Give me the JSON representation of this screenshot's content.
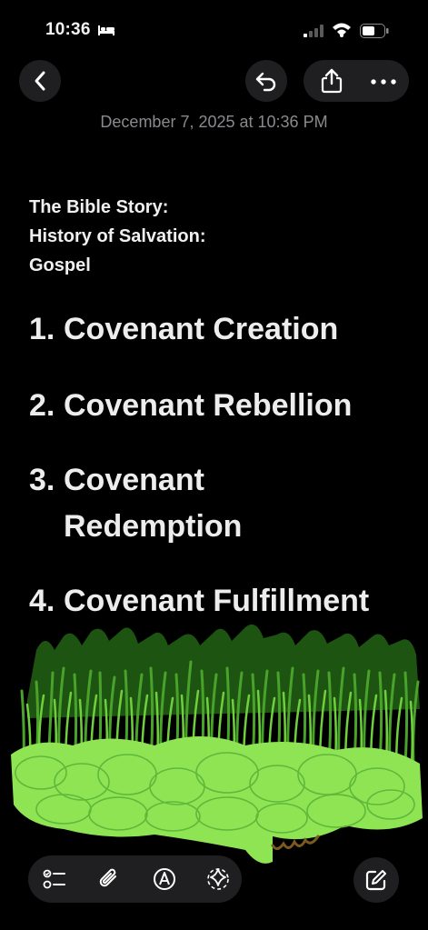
{
  "status_bar": {
    "time": "10:36"
  },
  "note": {
    "date": "December 7, 2025 at 10:36 PM",
    "intro_lines": [
      "The Bible Story:",
      "History of Salvation:",
      "Gospel"
    ],
    "items": [
      {
        "number": "1.",
        "text": "Covenant Creation"
      },
      {
        "number": "2.",
        "text": "Covenant Rebellion"
      },
      {
        "number": "3.",
        "text": "Covenant Redemption"
      },
      {
        "number": "4.",
        "text": "Covenant Fulfillment"
      }
    ]
  },
  "icons": {
    "back": "chevron-left-icon",
    "undo": "undo-icon",
    "share": "share-icon",
    "more": "ellipsis-icon",
    "checklist": "checklist-icon",
    "attach": "paperclip-icon",
    "markup": "pen-circle-icon",
    "ai": "sparkle-icon",
    "compose": "compose-icon"
  },
  "colors": {
    "background": "#000000",
    "date_text": "#8a8a8e",
    "control_bg": "#1f1f21",
    "grass_dark": "#1e5412",
    "grass_mid": "#49a22a",
    "grass_light": "#8ee453"
  }
}
